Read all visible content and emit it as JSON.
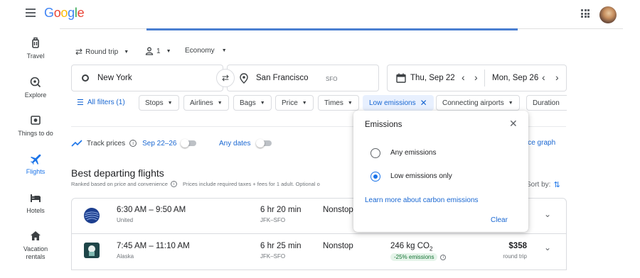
{
  "header": {
    "logo": "Google"
  },
  "sidebar": [
    {
      "label": "Travel",
      "icon": "luggage-icon"
    },
    {
      "label": "Explore",
      "icon": "explore-icon"
    },
    {
      "label": "Things to do",
      "icon": "camera-icon"
    },
    {
      "label": "Flights",
      "icon": "flight-icon"
    },
    {
      "label": "Hotels",
      "icon": "hotel-icon"
    },
    {
      "label": "Vacation rentals",
      "icon": "house-icon"
    }
  ],
  "search": {
    "trip_type": "Round trip",
    "passengers": "1",
    "cabin": "Economy",
    "origin": "New York",
    "destination": "San Francisco",
    "destination_code": "SFO",
    "depart_date": "Thu, Sep 22",
    "return_date": "Mon, Sep 26"
  },
  "filters": {
    "all": "All filters (1)",
    "chips": [
      "Stops",
      "Airlines",
      "Bags",
      "Price",
      "Times"
    ],
    "selected": "Low emissions",
    "connecting": "Connecting airports",
    "duration": "Duration"
  },
  "track": {
    "label": "Track prices",
    "dates": "Sep 22–26",
    "any_dates": "Any dates",
    "price_graph": "ice graph"
  },
  "results": {
    "title": "Best departing flights",
    "subtitle": "Ranked based on price and convenience",
    "note": "Prices include required taxes + fees for 1 adult. Optional o",
    "sort": "Sort by:",
    "flights": [
      {
        "time": "6:30 AM – 9:50 AM",
        "airline": "United",
        "duration": "6 hr 20 min",
        "route": "JFK–SFO",
        "stops": "Nonstop"
      },
      {
        "time": "7:45 AM – 11:10 AM",
        "airline": "Alaska",
        "duration": "6 hr 25 min",
        "route": "JFK–SFO",
        "stops": "Nonstop",
        "emissions": "246 kg CO",
        "emissions_sub": "2",
        "emissions_badge": "-25% emissions",
        "price": "$358",
        "price_sub": "round trip"
      }
    ]
  },
  "popup": {
    "title": "Emissions",
    "options": [
      "Any emissions",
      "Low emissions only"
    ],
    "selected_index": 1,
    "link": "Learn more about carbon emissions",
    "clear": "Clear"
  },
  "colors": {
    "accent": "#1a73e8",
    "chip_selected_bg": "#e8f0fe",
    "badge_bg": "#e6f4ea",
    "badge_text": "#137333"
  }
}
